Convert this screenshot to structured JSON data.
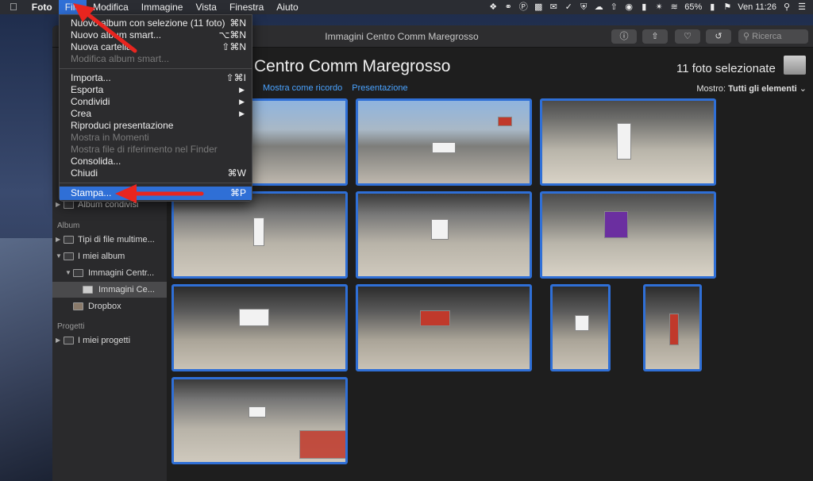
{
  "menubar": {
    "apple": "",
    "app": "Foto",
    "items": [
      "File",
      "Modifica",
      "Immagine",
      "Vista",
      "Finestra",
      "Aiuto"
    ],
    "battery": "65%",
    "clock": "Ven 11:26"
  },
  "window": {
    "title": "Immagini Centro Comm Maregrosso",
    "search_placeholder": "Ricerca"
  },
  "file_menu": {
    "items": [
      {
        "label": "Nuovo album con selezione (11 foto)",
        "shortcut": "⌘N",
        "disabled": false
      },
      {
        "label": "Nuovo album smart...",
        "shortcut": "⌥⌘N",
        "disabled": false
      },
      {
        "label": "Nuova cartella",
        "shortcut": "⇧⌘N",
        "disabled": false
      },
      {
        "label": "Modifica album smart...",
        "shortcut": "",
        "disabled": true
      },
      {
        "label": "Importa...",
        "shortcut": "⇧⌘I",
        "disabled": false
      },
      {
        "label": "Esporta",
        "shortcut": "▶",
        "disabled": false
      },
      {
        "label": "Condividi",
        "shortcut": "▶",
        "disabled": false
      },
      {
        "label": "Crea",
        "shortcut": "▶",
        "disabled": false
      },
      {
        "label": "Riproduci presentazione",
        "shortcut": "",
        "disabled": false
      },
      {
        "label": "Mostra in Momenti",
        "shortcut": "",
        "disabled": true
      },
      {
        "label": "Mostra file di riferimento nel Finder",
        "shortcut": "",
        "disabled": true
      },
      {
        "label": "Consolida...",
        "shortcut": "",
        "disabled": false
      },
      {
        "label": "Chiudi",
        "shortcut": "⌘W",
        "disabled": false
      },
      {
        "label": "Stampa...",
        "shortcut": "⌘P",
        "disabled": false
      }
    ]
  },
  "sidebar": {
    "shared_item": "Album condivisi",
    "album_section": "Album",
    "items": [
      "Tipi di file multime...",
      "I miei album",
      "Immagini Centr...",
      "Immagini Ce...",
      "Dropbox"
    ],
    "projects_section": "Progetti",
    "projects_item": "I miei progetti"
  },
  "main": {
    "title": "Centro Comm Maregrosso",
    "selected_count": "11 foto selezionate",
    "link_memory": "Mostra come ricordo",
    "link_slideshow": "Presentazione",
    "show_label": "Mostro:",
    "show_value": "Tutti gli elementi"
  },
  "colors": {
    "accent": "#2f6fd6",
    "link": "#4aa3ff",
    "annotation": "#e8251f"
  }
}
